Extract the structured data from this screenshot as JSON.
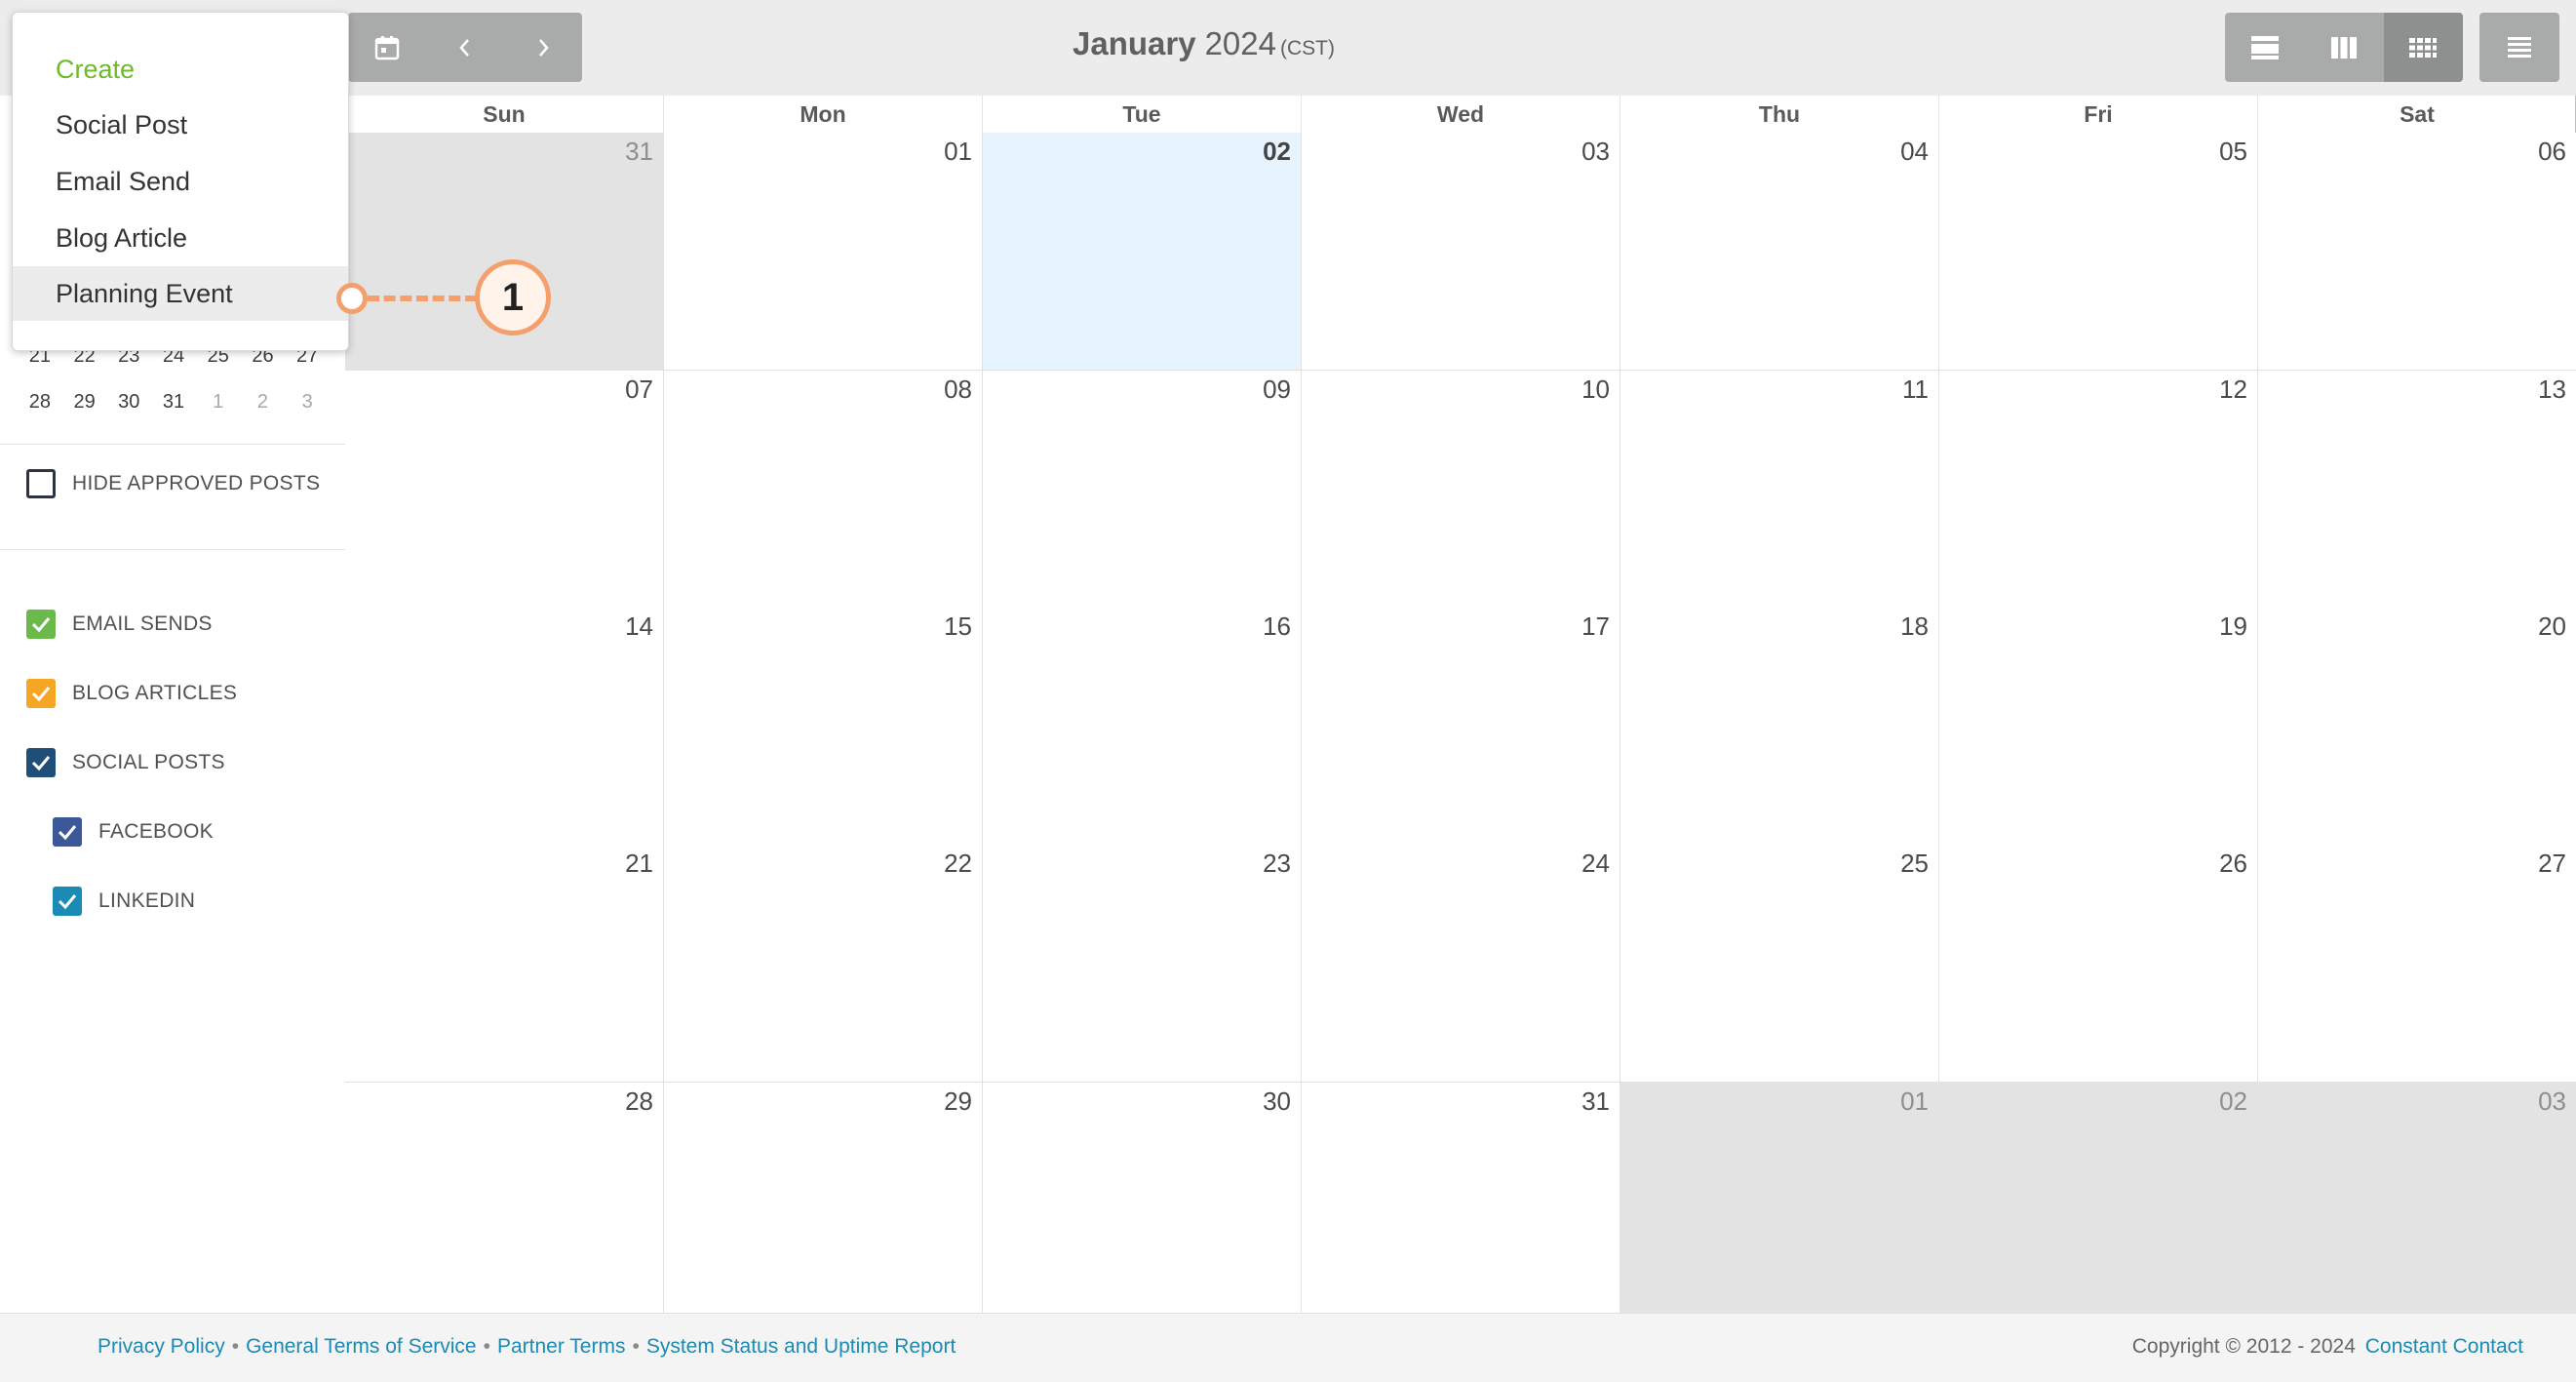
{
  "header": {
    "month": "January",
    "year": "2024",
    "timezone": "(CST)"
  },
  "create_menu": {
    "items": [
      "Create",
      "Social Post",
      "Email Send",
      "Blog Article",
      "Planning Event"
    ]
  },
  "callout": {
    "number": "1"
  },
  "mini_calendar": {
    "rows": [
      [
        "21",
        "22",
        "23",
        "24",
        "25",
        "26",
        "27"
      ],
      [
        "28",
        "29",
        "30",
        "31",
        "1",
        "2",
        "3"
      ]
    ]
  },
  "filters": {
    "hide_approved": "HIDE APPROVED POSTS",
    "email_sends": "EMAIL SENDS",
    "blog_articles": "BLOG ARTICLES",
    "social_posts": "SOCIAL POSTS",
    "facebook": "FACEBOOK",
    "linkedin": "LINKEDIN"
  },
  "colors": {
    "email_sends": "#6ab94a",
    "blog_articles": "#f5a623",
    "social_posts": "#1f4e79",
    "facebook": "#3b5998",
    "linkedin": "#1b8bb5",
    "accent_green": "#6fba2c",
    "callout": "#f4a06c",
    "today": "#e8f4fd"
  },
  "calendar": {
    "weekdays": [
      "Sun",
      "Mon",
      "Tue",
      "Wed",
      "Thu",
      "Fri",
      "Sat"
    ],
    "weeks": [
      [
        "31",
        "01",
        "02",
        "03",
        "04",
        "05",
        "06"
      ],
      [
        "07",
        "08",
        "09",
        "10",
        "11",
        "12",
        "13"
      ],
      [
        "14",
        "15",
        "16",
        "17",
        "18",
        "19",
        "20"
      ],
      [
        "21",
        "22",
        "23",
        "24",
        "25",
        "26",
        "27"
      ],
      [
        "28",
        "29",
        "30",
        "31",
        "01",
        "02",
        "03"
      ]
    ],
    "today": "02"
  },
  "footer": {
    "links": [
      "Privacy Policy",
      "General Terms of Service",
      "Partner Terms",
      "System Status and Uptime Report"
    ],
    "separator": "•",
    "copyright": "Copyright © 2012 - 2024",
    "company": "Constant Contact"
  }
}
